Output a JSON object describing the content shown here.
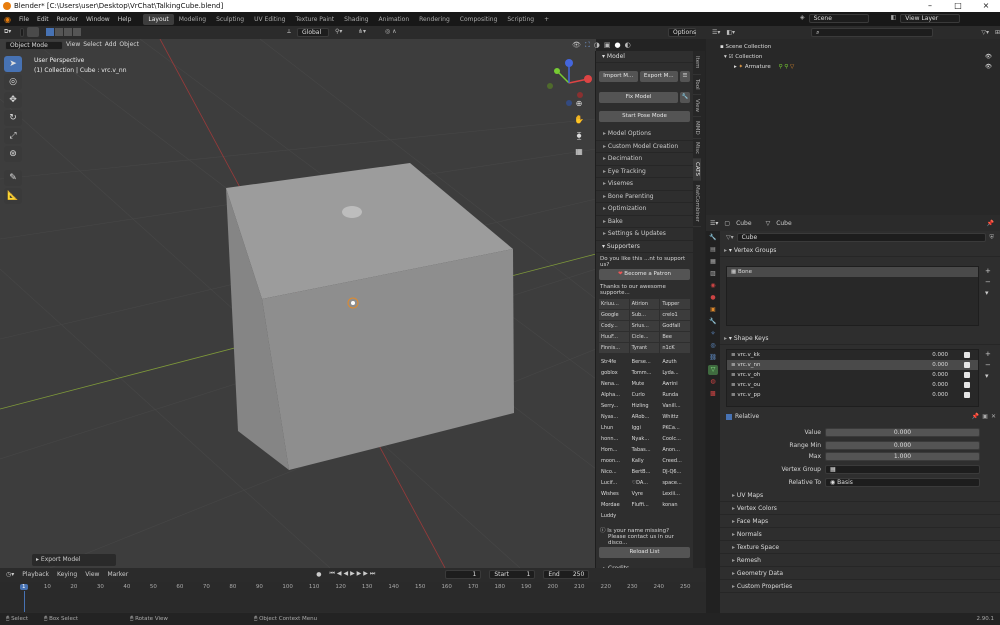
{
  "window": {
    "title": "Blender* [C:\\Users\\user\\Desktop\\VrChat\\TalkingCube.blend]"
  },
  "topbar": {
    "menus": [
      "File",
      "Edit",
      "Render",
      "Window",
      "Help"
    ],
    "workspaces": [
      "Layout",
      "Modeling",
      "Sculpting",
      "UV Editing",
      "Texture Paint",
      "Shading",
      "Animation",
      "Rendering",
      "Compositing",
      "Scripting"
    ],
    "scene": "Scene",
    "view_layer": "View Layer"
  },
  "viewport_header": {
    "mode": "Object Mode",
    "menus": [
      "View",
      "Select",
      "Add",
      "Object"
    ],
    "orientation": "Global",
    "options": "Options"
  },
  "viewport": {
    "line1": "User Perspective",
    "line2": "(1) Collection | Cube : vrc.v_nn",
    "last_op": "Export Model"
  },
  "cats": {
    "model_header": "Model",
    "import": "Import M...",
    "export": "Export M...",
    "fix": "Fix Model",
    "pose": "Start Pose Mode",
    "sections": [
      "Model Options",
      "Custom Model Creation",
      "Decimation",
      "Eye Tracking",
      "Visemes",
      "Bone Parenting",
      "Optimization",
      "Bake",
      "Settings & Updates"
    ],
    "supporters_header": "Supporters",
    "support_q": "Do you like this ...nt to support us?",
    "patron": "Become a Patron",
    "thanks": "Thanks to our awesome supporte...",
    "supporters_top": [
      "Kriuu...",
      "Atirion",
      "Tupper",
      "Google",
      "Sub...",
      "crelo1",
      "Cody...",
      "Srius...",
      "Godfall",
      "HuuF...",
      "Cicle...",
      "Bee",
      "Finnis...",
      "Tyrant",
      "n1cK"
    ],
    "supporters_rest": [
      "Str4fe",
      "Berse...",
      "Azuth",
      "goblox",
      "Tomm...",
      "Lyda...",
      "Nena...",
      "Mute",
      "Awrini",
      "Alpha...",
      "Curlo",
      "Runda",
      "Serry...",
      "Hizling",
      "Vanill...",
      "Nyas...",
      "ARob...",
      "Whittz",
      "Lhun",
      "Iggi",
      "PKCa...",
      "honn...",
      "Nyak...",
      "Coolc...",
      "Hom...",
      "Tabas...",
      "Anon...",
      "moon...",
      "Kally",
      "Creed...",
      "Nico...",
      "BertB...",
      "DJ-Q6...",
      "Lucif...",
      "♡DA...",
      "space...",
      "Wishes",
      "Vyre",
      "Lexiii...",
      "Mordae",
      "Fluffi...",
      "konan",
      "Luddy"
    ],
    "missing1": "Is your name missing?",
    "missing2": "Please contact us in our disco...",
    "reload": "Reload List",
    "credits": "Credits"
  },
  "vtabs": [
    "Item",
    "Tool",
    "View",
    "MMD",
    "Misc",
    "CATS",
    "MatCombiner"
  ],
  "outliner": {
    "scene_collection": "Scene Collection",
    "collection": "Collection",
    "armature": "Armature"
  },
  "props": {
    "object": "Cube",
    "mesh": "Cube",
    "name": "Cube",
    "vertex_groups": "Vertex Groups",
    "vg_item": "Bone",
    "shape_keys": "Shape Keys",
    "keys": [
      {
        "name": "vrc.v_kk",
        "value": "0.000"
      },
      {
        "name": "vrc.v_nn",
        "value": "0.000"
      },
      {
        "name": "vrc.v_oh",
        "value": "0.000"
      },
      {
        "name": "vrc.v_ou",
        "value": "0.000"
      },
      {
        "name": "vrc.v_pp",
        "value": "0.000"
      }
    ],
    "relative": "Relative",
    "value_label": "Value",
    "value": "0.000",
    "range_min_label": "Range Min",
    "range_min": "0.000",
    "max_label": "Max",
    "max": "1.000",
    "vertex_group_label": "Vertex Group",
    "relative_to_label": "Relative To",
    "relative_to": "Basis",
    "sections": [
      "UV Maps",
      "Vertex Colors",
      "Face Maps",
      "Normals",
      "Texture Space",
      "Remesh",
      "Geometry Data",
      "Custom Properties"
    ]
  },
  "timeline": {
    "menus": [
      "Playback",
      "Keying",
      "View",
      "Marker"
    ],
    "current": "1",
    "start_label": "Start",
    "start": "1",
    "end_label": "End",
    "end": "250",
    "ticks": [
      "1",
      "10",
      "20",
      "30",
      "40",
      "50",
      "60",
      "70",
      "80",
      "90",
      "100",
      "110",
      "120",
      "130",
      "140",
      "150",
      "160",
      "170",
      "180",
      "190",
      "200",
      "210",
      "220",
      "230",
      "240",
      "250"
    ]
  },
  "status": {
    "select": "Select",
    "box": "Box Select",
    "rotate": "Rotate View",
    "context": "Object Context Menu",
    "version": "2.90.1"
  }
}
